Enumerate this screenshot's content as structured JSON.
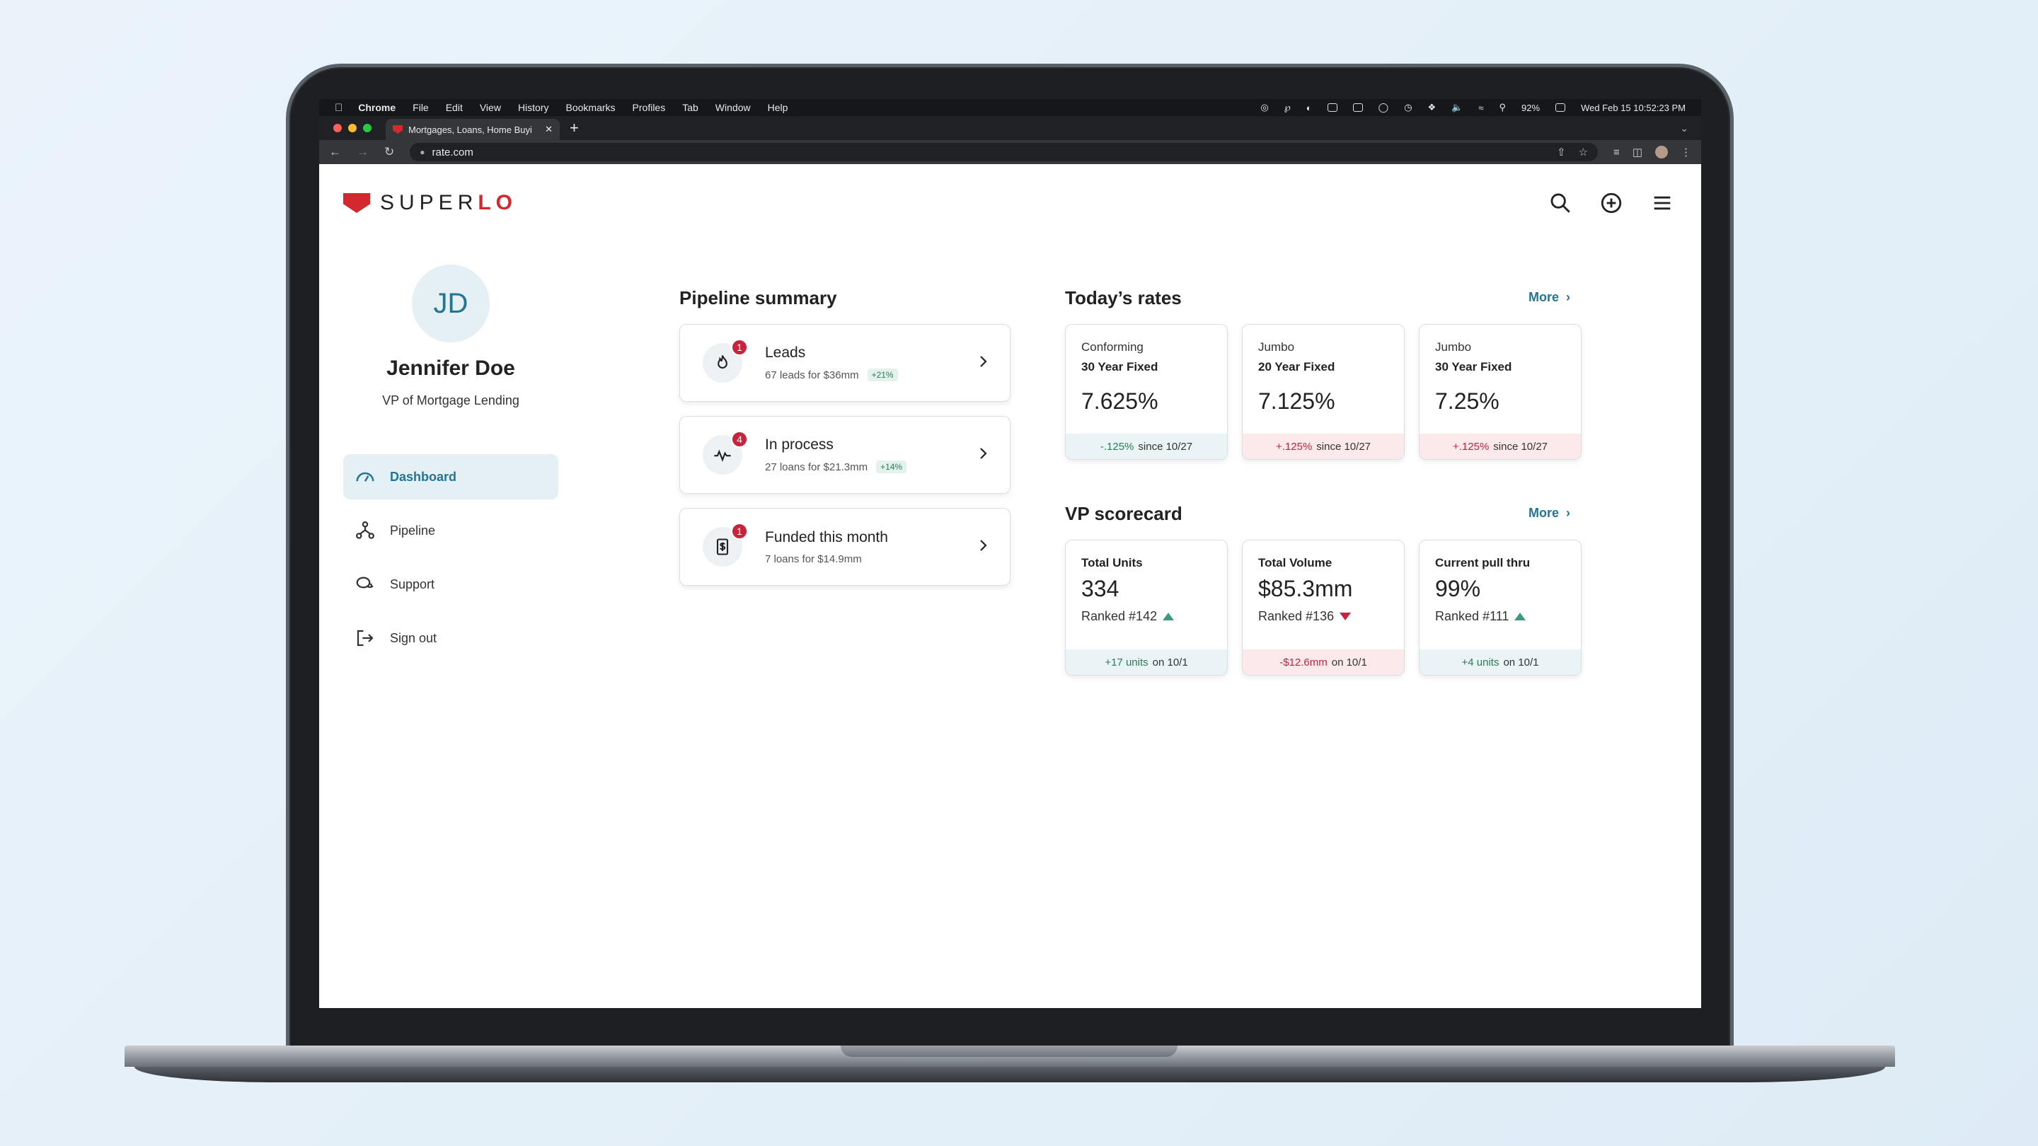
{
  "menubar": {
    "app": "Chrome",
    "items": [
      "File",
      "Edit",
      "View",
      "History",
      "Bookmarks",
      "Profiles",
      "Tab",
      "Window",
      "Help"
    ],
    "battery": "92%",
    "datetime": "Wed Feb 15  10:52:23 PM"
  },
  "browser": {
    "tab_title": "Mortgages, Loans, Home Buyi",
    "url": "rate.com"
  },
  "brand": {
    "logo_left": "SUPER",
    "logo_right": "LO",
    "accent": "#d4282f"
  },
  "profile": {
    "initials": "JD",
    "name": "Jennifer Doe",
    "title": "VP of Mortgage Lending"
  },
  "nav": {
    "items": [
      {
        "label": "Dashboard",
        "icon": "gauge-icon"
      },
      {
        "label": "Pipeline",
        "icon": "network-icon"
      },
      {
        "label": "Support",
        "icon": "chat-icon"
      },
      {
        "label": "Sign out",
        "icon": "sign-out-icon"
      }
    ]
  },
  "pipeline": {
    "title": "Pipeline summary",
    "cards": [
      {
        "label": "Leads",
        "sub": "67 leads for $36mm",
        "tag": "+21%",
        "badge": "1",
        "icon": "flame-icon"
      },
      {
        "label": "In process",
        "sub": "27 loans for $21.3mm",
        "tag": "+14%",
        "badge": "4",
        "icon": "pulse-icon"
      },
      {
        "label": "Funded this month",
        "sub": "7 loans for $14.9mm",
        "tag": "",
        "badge": "1",
        "icon": "receipt-icon"
      }
    ]
  },
  "rates": {
    "title": "Today’s rates",
    "more": "More",
    "cards": [
      {
        "category": "Conforming",
        "term": "30 Year Fixed",
        "value": "7.625%",
        "change": "-.125%",
        "since": "since 10/27",
        "direction": "down"
      },
      {
        "category": "Jumbo",
        "term": "20 Year Fixed",
        "value": "7.125%",
        "change": "+.125%",
        "since": "since 10/27",
        "direction": "up"
      },
      {
        "category": "Jumbo",
        "term": "30 Year Fixed",
        "value": "7.25%",
        "change": "+.125%",
        "since": "since 10/27",
        "direction": "up"
      }
    ]
  },
  "scorecard": {
    "title": "VP scorecard",
    "more": "More",
    "cards": [
      {
        "title": "Total Units",
        "value": "334",
        "rank": "Ranked #142",
        "trend": "up",
        "change": "+17 units",
        "on": "on 10/1"
      },
      {
        "title": "Total Volume",
        "value": "$85.3mm",
        "rank": "Ranked #136",
        "trend": "down",
        "change": "-$12.6mm",
        "on": "on 10/1"
      },
      {
        "title": "Current pull thru",
        "value": "99%",
        "rank": "Ranked #111",
        "trend": "up",
        "change": "+4 units",
        "on": "on 10/1"
      }
    ]
  }
}
